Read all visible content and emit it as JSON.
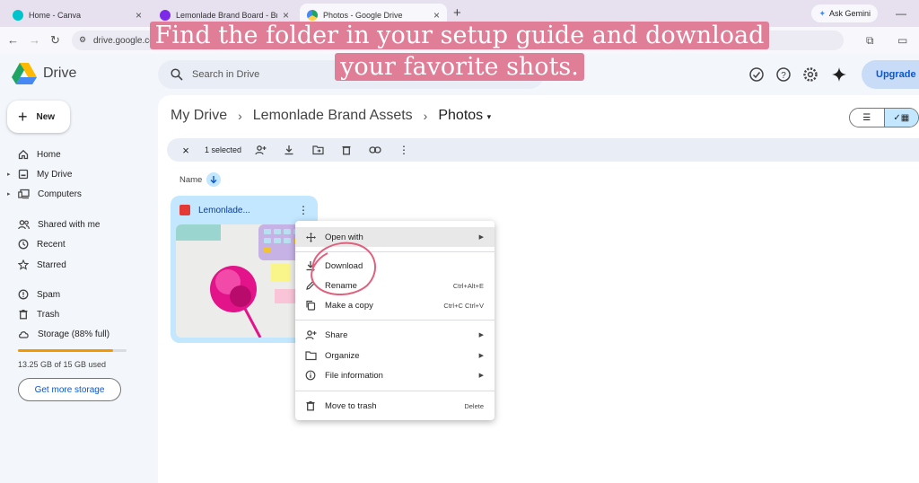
{
  "browser": {
    "tabs": [
      {
        "title": "Home - Canva",
        "active": false,
        "color": "#00c4cc"
      },
      {
        "title": "Lemonlade Brand Board - Bran",
        "active": false,
        "color": "#7d2ae8"
      },
      {
        "title": "Photos - Google Drive",
        "active": true,
        "color": "#1fa463"
      }
    ],
    "ask_gemini": "Ask Gemini",
    "url": "drive.google.co"
  },
  "caption": {
    "line1": "Find the folder in your setup guide and download",
    "line2": "your favorite shots."
  },
  "drive": {
    "product_name": "Drive",
    "search_placeholder": "Search in Drive",
    "upgrade_label": "Upgrade",
    "new_label": "New"
  },
  "sidebar": {
    "items": [
      {
        "label": "Home",
        "icon": "home-icon"
      },
      {
        "label": "My Drive",
        "icon": "my-drive-icon"
      },
      {
        "label": "Computers",
        "icon": "computer-icon"
      },
      {
        "label": "Shared with me",
        "icon": "shared-icon"
      },
      {
        "label": "Recent",
        "icon": "clock-icon"
      },
      {
        "label": "Starred",
        "icon": "star-icon"
      },
      {
        "label": "Spam",
        "icon": "spam-icon"
      },
      {
        "label": "Trash",
        "icon": "trash-icon"
      },
      {
        "label": "Storage (88% full)",
        "icon": "cloud-icon"
      }
    ],
    "storage_used_fraction": 0.88,
    "storage_text": "13.25 GB of 15 GB used",
    "get_storage_label": "Get more storage"
  },
  "breadcrumb": {
    "items": [
      "My Drive",
      "Lemonlade Brand Assets",
      "Photos"
    ]
  },
  "selection_bar": {
    "count_label": "1 selected"
  },
  "sort": {
    "label": "Name"
  },
  "file_card": {
    "name": "Lemonlade..."
  },
  "context_menu": {
    "items": [
      {
        "label": "Open with",
        "shortcut": "",
        "submenu": true,
        "icon": "open-with-icon"
      },
      {
        "label": "Download",
        "shortcut": "",
        "submenu": false,
        "icon": "download-icon"
      },
      {
        "label": "Rename",
        "shortcut": "Ctrl+Alt+E",
        "submenu": false,
        "icon": "rename-icon"
      },
      {
        "label": "Make a copy",
        "shortcut": "Ctrl+C Ctrl+V",
        "submenu": false,
        "icon": "copy-icon"
      },
      {
        "label": "Share",
        "shortcut": "",
        "submenu": true,
        "icon": "share-icon"
      },
      {
        "label": "Organize",
        "shortcut": "",
        "submenu": true,
        "icon": "folder-icon"
      },
      {
        "label": "File information",
        "shortcut": "",
        "submenu": true,
        "icon": "info-icon"
      },
      {
        "label": "Move to trash",
        "shortcut": "Delete",
        "submenu": false,
        "icon": "trash-icon"
      }
    ]
  },
  "colors": {
    "caption_bg": "#e07d97",
    "accent_blue": "#0b57d0",
    "selected_bg": "#c2e7ff",
    "storage_fill": "#f29900"
  }
}
